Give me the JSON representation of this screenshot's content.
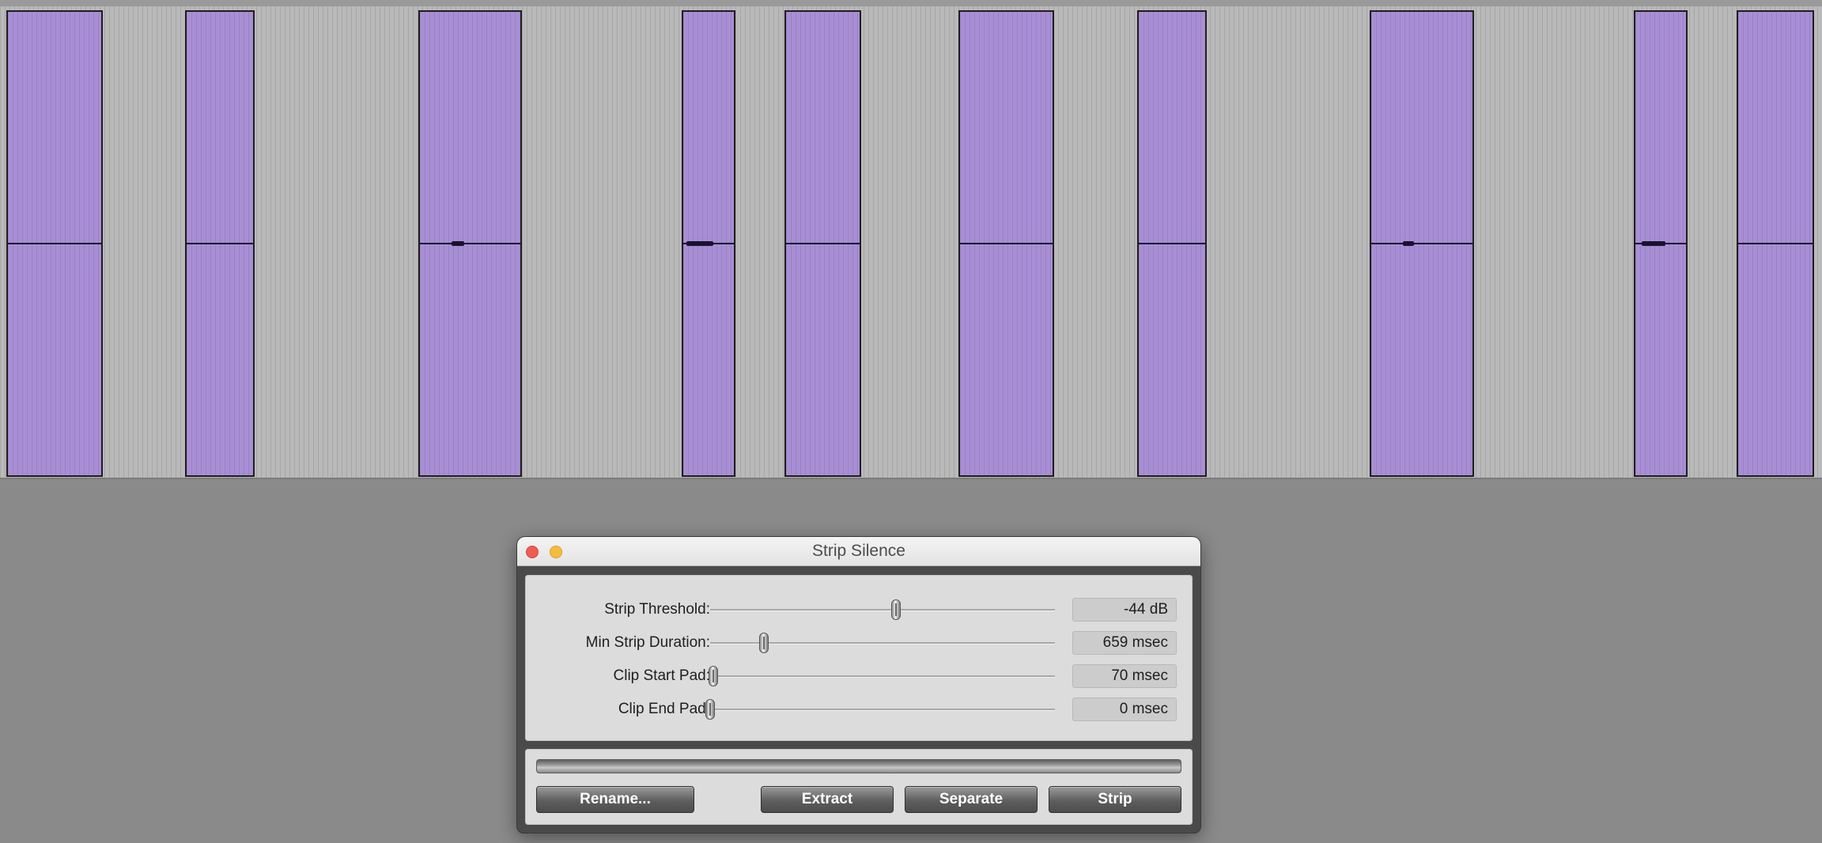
{
  "track": {
    "clip_count": 11
  },
  "dialog": {
    "title": "Strip Silence",
    "params": [
      {
        "label": "Strip Threshold:",
        "value": "-44 dB",
        "slider_fraction": 0.54
      },
      {
        "label": "Min Strip Duration:",
        "value": "659 msec",
        "slider_fraction": 0.155
      },
      {
        "label": "Clip Start Pad:",
        "value": "70 msec",
        "slider_fraction": 0.01
      },
      {
        "label": "Clip End Pad:",
        "value": "0 msec",
        "slider_fraction": 0.0
      }
    ],
    "progress_fraction": 0,
    "buttons": {
      "rename": "Rename...",
      "extract": "Extract",
      "separate": "Separate",
      "strip": "Strip"
    }
  },
  "colors": {
    "clip_fill": "#a88fd4",
    "clip_border": "#1e1e1e",
    "track_bg": "#b9b9b9",
    "desktop_bg": "#8a8a8a",
    "close_button": "#ee5d55",
    "minimize_button": "#f5bd3f"
  }
}
